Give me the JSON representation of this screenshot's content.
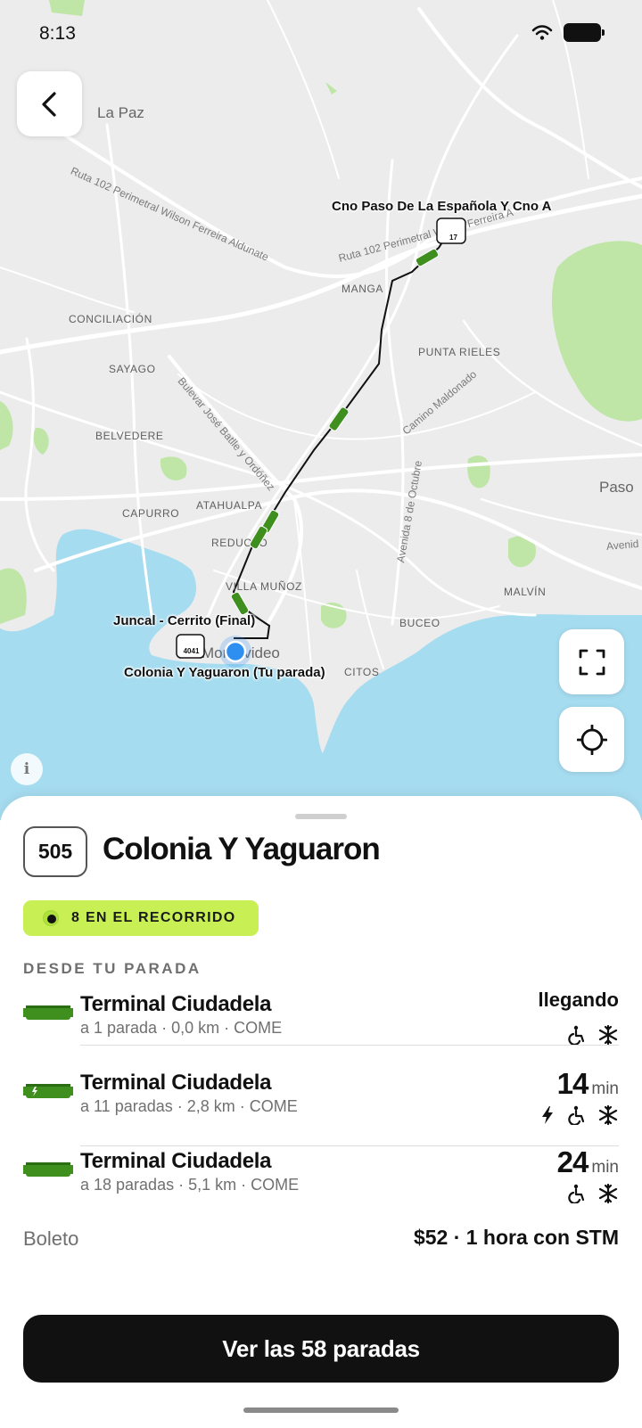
{
  "status_bar": {
    "time": "8:13"
  },
  "map": {
    "place_labels": [
      {
        "key": "la-paz",
        "text": "La Paz"
      },
      {
        "key": "conciliacion",
        "text": "CONCILIACIÓN"
      },
      {
        "key": "sayago",
        "text": "SAYAGO"
      },
      {
        "key": "belvedere",
        "text": "BELVEDERE"
      },
      {
        "key": "capurro",
        "text": "CAPURRO"
      },
      {
        "key": "atahualpa",
        "text": "ATAHUALPA"
      },
      {
        "key": "reducto",
        "text": "REDUCTO"
      },
      {
        "key": "villa-munoz",
        "text": "VILLA MUÑOZ"
      },
      {
        "key": "manga",
        "text": "MANGA"
      },
      {
        "key": "punta-rieles",
        "text": "PUNTA RIELES"
      },
      {
        "key": "malvin",
        "text": "MALVÍN"
      },
      {
        "key": "buceo",
        "text": "BUCEO"
      },
      {
        "key": "pocitos",
        "text": "CITOS"
      },
      {
        "key": "montevideo",
        "text": "Montevideo"
      },
      {
        "key": "paso",
        "text": "Paso"
      }
    ],
    "road_labels": [
      {
        "key": "ruta102-wilson",
        "text": "Ruta 102 Perimetral Wilson Ferreira Aldunate"
      },
      {
        "key": "ruta102-ferreira",
        "text": "Ruta 102 Perimetral Wilson Ferreira A"
      },
      {
        "key": "bulevar-batlle",
        "text": "Bulevar José Batlle y Ordóñez"
      },
      {
        "key": "camino-maldonado",
        "text": "Camino Maldonado"
      },
      {
        "key": "avenida-8-octubre",
        "text": "Avenida 8 de Octubre"
      },
      {
        "key": "avenida-italia",
        "text": "Avenid"
      }
    ],
    "stops": {
      "end": "Cno Paso De La Española Y Cno A",
      "final": "Juncal - Cerrito (Final)",
      "mine": "Colonia Y Yaguaron (Tu parada)",
      "stop_code_start": "4041",
      "stop_code_end": "17"
    },
    "route_number": "505",
    "colors": {
      "water": "#a6dcf0",
      "park": "#bfe6a6",
      "route": "#111111",
      "bus": "#3f8f1f",
      "user_dot": "#2f8ff0"
    }
  },
  "sheet": {
    "route_number": "505",
    "stop_name": "Colonia Y Yaguaron",
    "live_badge": "8 EN EL RECORRIDO",
    "section_title": "DESDE TU PARADA",
    "arrivals": [
      {
        "destination": "Terminal Ciudadela",
        "meta": "a 1 parada · 0,0 km · COME",
        "eta_word": "llegando",
        "eta_number": "",
        "eta_unit": "",
        "electric": false,
        "features": [
          "wheelchair-icon",
          "air-conditioning-icon"
        ]
      },
      {
        "destination": "Terminal Ciudadela",
        "meta": "a 11 paradas · 2,8 km · COME",
        "eta_word": "",
        "eta_number": "14",
        "eta_unit": "min",
        "electric": true,
        "features": [
          "electric-bolt-icon",
          "wheelchair-icon",
          "air-conditioning-icon"
        ]
      },
      {
        "destination": "Terminal Ciudadela",
        "meta": "a 18 paradas · 5,1 km · COME",
        "eta_word": "",
        "eta_number": "24",
        "eta_unit": "min",
        "electric": false,
        "features": [
          "wheelchair-icon",
          "air-conditioning-icon"
        ]
      }
    ],
    "ticket_label": "Boleto",
    "ticket_value": "$52 · 1 hora con STM",
    "cta_label": "Ver las 58 paradas"
  },
  "colors": {
    "accent": "#c8f055",
    "bus_green": "#3f8f1f",
    "cta_bg": "#111111"
  }
}
